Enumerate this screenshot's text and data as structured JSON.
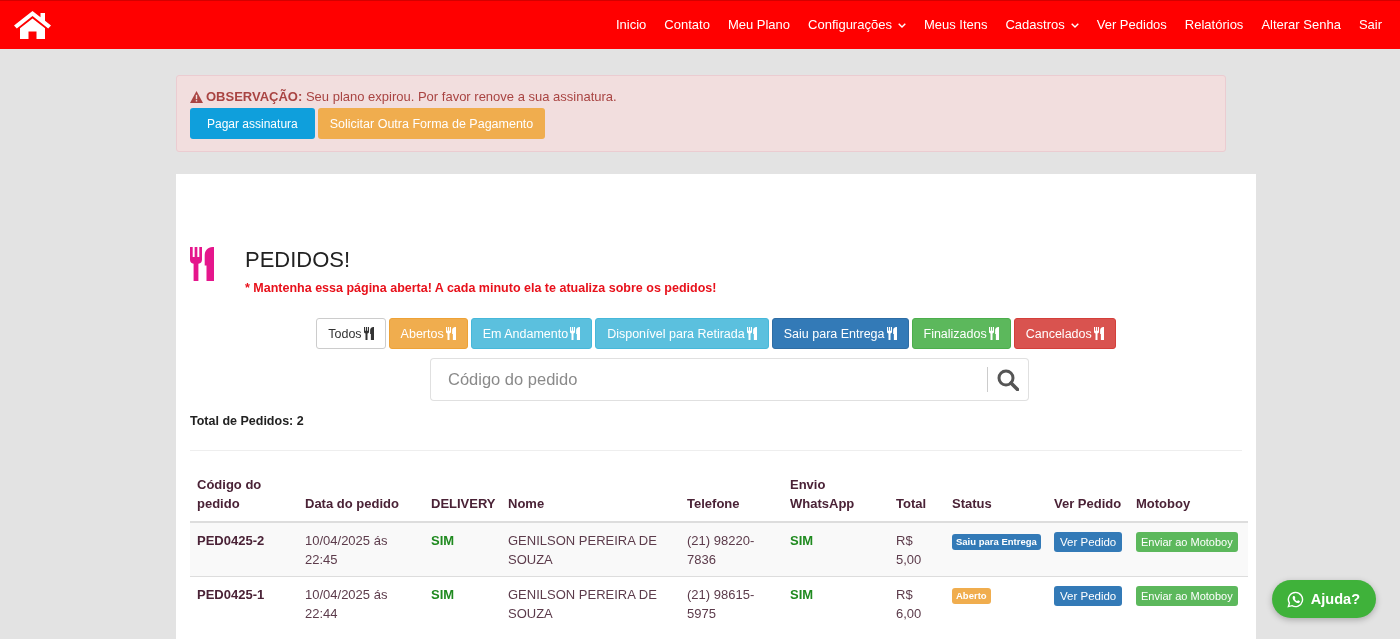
{
  "navbar": {
    "items": [
      {
        "label": "Inicio",
        "has_menu": false
      },
      {
        "label": "Contato",
        "has_menu": false
      },
      {
        "label": "Meu Plano",
        "has_menu": false
      },
      {
        "label": "Configurações",
        "has_menu": true
      },
      {
        "label": "Meus Itens",
        "has_menu": false
      },
      {
        "label": "Cadastros",
        "has_menu": true
      },
      {
        "label": "Ver Pedidos",
        "has_menu": false
      },
      {
        "label": "Relatórios",
        "has_menu": false
      },
      {
        "label": "Alterar Senha",
        "has_menu": false
      },
      {
        "label": "Sair",
        "has_menu": false
      }
    ]
  },
  "alert": {
    "message": "**OBSERVAÇÃO:** Seu plano expirou. Por favor renove a sua assinatura.",
    "buttons": [
      {
        "label": "Pagar assinatura",
        "kind": "info"
      },
      {
        "label": "Solicitar Outra Forma de Pagamento",
        "kind": "warning"
      }
    ]
  },
  "orders": {
    "title": "PEDIDOS!",
    "notice": "* Mantenha essa página aberta! A cada minuto ela te atualiza sobre os pedidos!",
    "filters": [
      {
        "label": "Todos",
        "kind": "default"
      },
      {
        "label": "Abertos",
        "kind": "warning"
      },
      {
        "label": "Em Andamento",
        "kind": "info"
      },
      {
        "label": "Disponível para Retirada",
        "kind": "info"
      },
      {
        "label": "Saiu para Entrega",
        "kind": "primary"
      },
      {
        "label": "Finalizados",
        "kind": "success"
      },
      {
        "label": "Cancelados",
        "kind": "danger"
      }
    ],
    "search": {
      "placeholder": "Código do pedido"
    },
    "total": "Total de Pedidos: 2",
    "table": {
      "columns": [
        "Código do pedido",
        "Data do pedido",
        "DELIVERY",
        "Nome",
        "Telefone",
        "Envio WhatsApp",
        "Total",
        "Status",
        "Ver Pedido",
        "Motoboy"
      ],
      "rows": [
        {
          "code": "PED0425-2",
          "date": "10/04/2025 ás 22:45",
          "delivery": "SIM",
          "name": "GENILSON PEREIRA DE SOUZA",
          "phone": "(21) 98220-7836",
          "whatsapp": "SIM",
          "total": "R$ 5,00",
          "status": {
            "label": "Saiu para Entrega",
            "kind": "primary"
          },
          "view_button": "Ver Pedido",
          "motoboy_button": "Enviar ao Motoboy"
        },
        {
          "code": "PED0425-1",
          "date": "10/04/2025 ás 22:44",
          "delivery": "SIM",
          "name": "GENILSON PEREIRA DE SOUZA",
          "phone": "(21) 98615-5975",
          "whatsapp": "SIM",
          "total": "R$ 6,00",
          "status": {
            "label": "Aberto",
            "kind": "warning"
          },
          "view_button": "Ver Pedido",
          "motoboy_button": "Enviar ao Motoboy"
        }
      ]
    }
  },
  "help_button": {
    "label": "Ajuda?"
  }
}
